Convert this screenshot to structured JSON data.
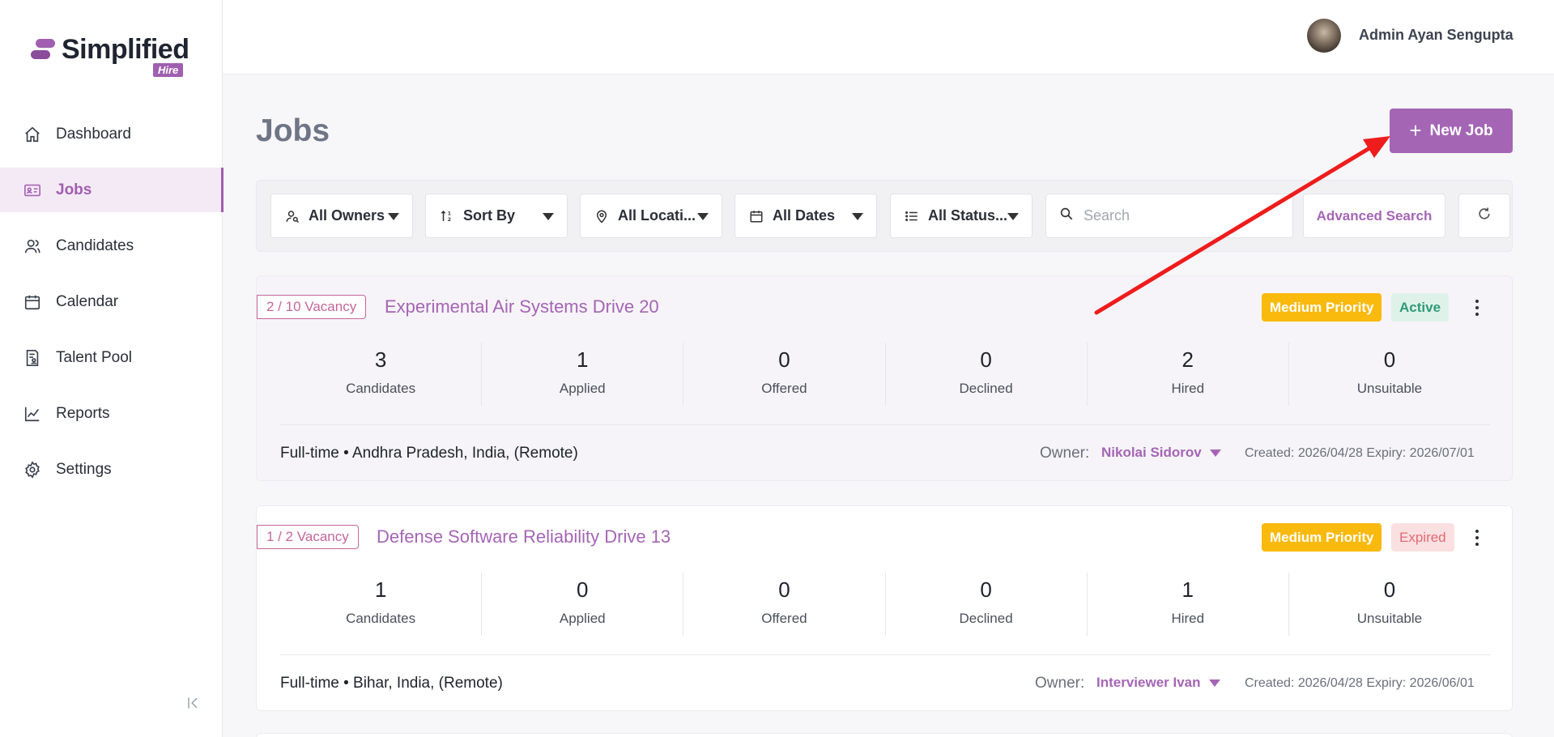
{
  "brand": {
    "name": "Simplified",
    "sub": "Hire",
    "accent": "#a565b5"
  },
  "user": {
    "name": "Admin Ayan Sengupta"
  },
  "sidebar": {
    "items": [
      {
        "label": "Dashboard",
        "icon": "home-icon"
      },
      {
        "label": "Jobs",
        "icon": "id-card-icon",
        "active": true
      },
      {
        "label": "Candidates",
        "icon": "users-icon"
      },
      {
        "label": "Calendar",
        "icon": "calendar-icon"
      },
      {
        "label": "Talent Pool",
        "icon": "document-user-icon"
      },
      {
        "label": "Reports",
        "icon": "line-chart-icon"
      },
      {
        "label": "Settings",
        "icon": "gear-icon"
      }
    ]
  },
  "page": {
    "title": "Jobs",
    "new_job_label": "New Job"
  },
  "filters": {
    "owners": "All Owners",
    "sort": "Sort By",
    "locations": "All Locati...",
    "dates": "All Dates",
    "status": "All Status...",
    "search_placeholder": "Search",
    "advanced": "Advanced Search"
  },
  "stat_labels": [
    "Candidates",
    "Applied",
    "Offered",
    "Declined",
    "Hired",
    "Unsuitable"
  ],
  "jobs": [
    {
      "vacancy": "2 / 10 Vacancy",
      "title": "Experimental Air Systems Drive 20",
      "priority": "Medium Priority",
      "status": "Active",
      "stats": [
        "3",
        "1",
        "0",
        "0",
        "2",
        "0"
      ],
      "meta": "Full-time • Andhra Pradesh, India, (Remote)",
      "owner_label": "Owner:",
      "owner": "Nikolai Sidorov",
      "dates": "Created: 2026/04/28   Expiry: 2026/07/01"
    },
    {
      "vacancy": "1 / 2 Vacancy",
      "title": "Defense Software Reliability Drive 13",
      "priority": "Medium Priority",
      "status": "Expired",
      "stats": [
        "1",
        "0",
        "0",
        "0",
        "1",
        "0"
      ],
      "meta": "Full-time • Bihar, India, (Remote)",
      "owner_label": "Owner:",
      "owner": "Interviewer Ivan",
      "dates": "Created: 2026/04/28   Expiry: 2026/06/01"
    }
  ]
}
